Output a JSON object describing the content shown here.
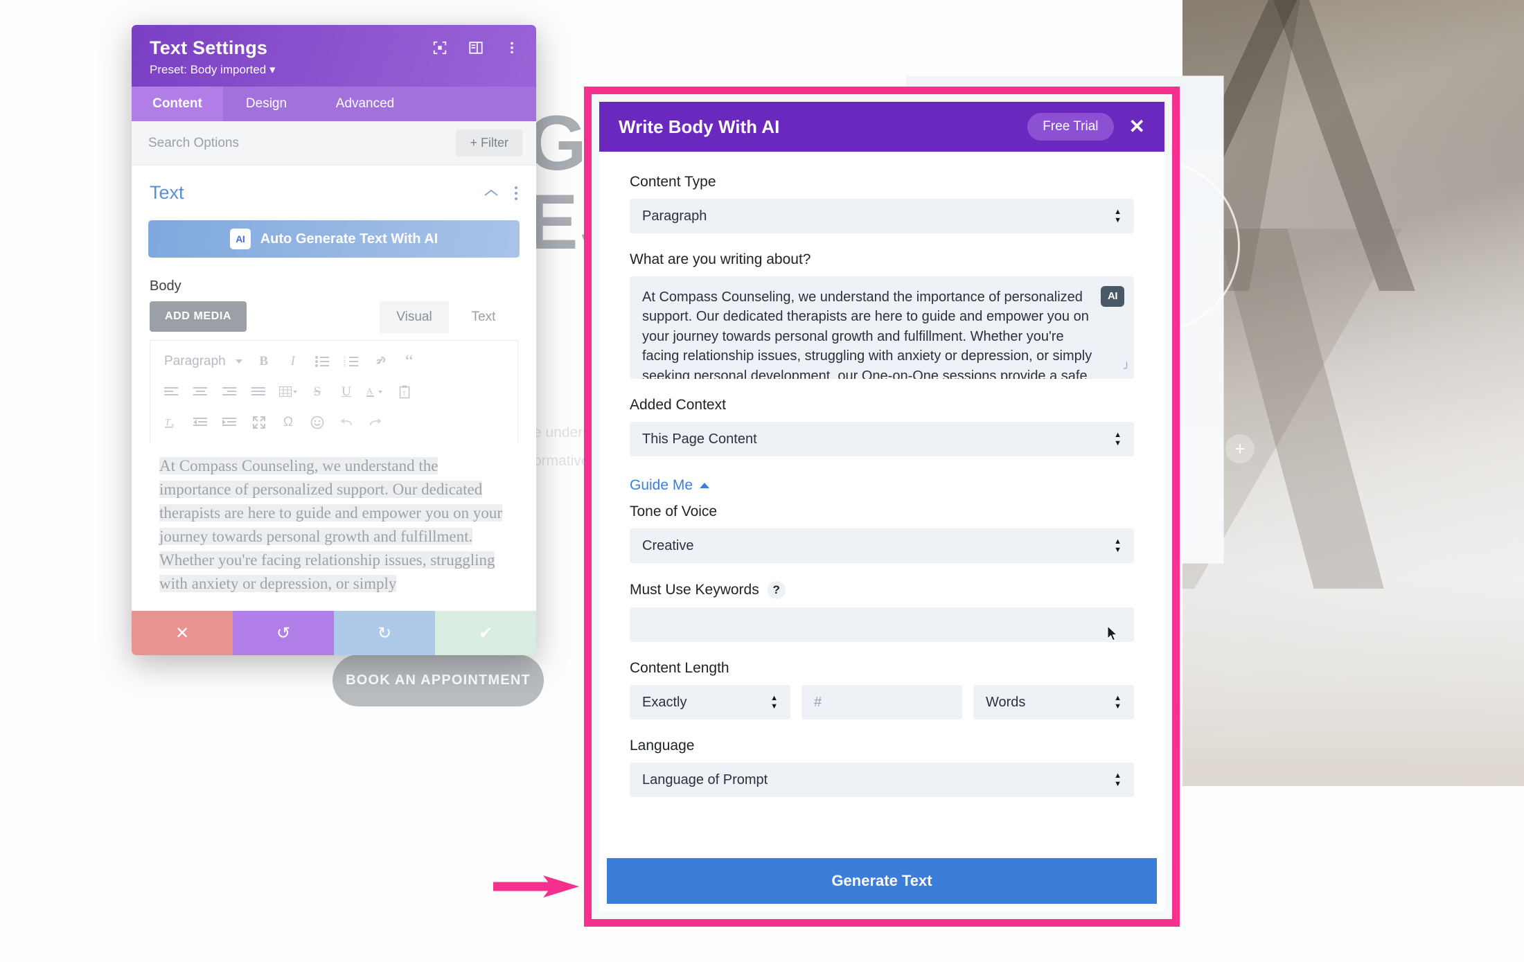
{
  "background_page": {
    "heading": "GIN\nES",
    "body_fragments": "e unders\nere to\nether\ning p\nyou to\ncan disc\normative",
    "cta_label": "BOOK AN APPOINTMENT",
    "add_icon": "plus-icon"
  },
  "settings_panel": {
    "title": "Text Settings",
    "preset": "Preset: Body imported",
    "preset_caret": "▾",
    "header_icons": [
      "focus-target-icon",
      "layout-panel-icon",
      "more-vertical-icon"
    ],
    "tabs": [
      {
        "label": "Content",
        "active": true
      },
      {
        "label": "Design",
        "active": false
      },
      {
        "label": "Advanced",
        "active": false
      }
    ],
    "search_placeholder": "Search Options",
    "filter_label": "Filter",
    "filter_icon": "plus-icon",
    "section": {
      "title": "Text",
      "collapse_icon": "chevron-up-icon",
      "menu_icon": "more-vertical-icon"
    },
    "ai_generate_button": "Auto Generate Text With AI",
    "ai_chip_label": "AI",
    "body_label": "Body",
    "add_media_label": "ADD MEDIA",
    "editor_tabs": [
      {
        "label": "Visual",
        "active": true
      },
      {
        "label": "Text",
        "active": false
      }
    ],
    "toolbar": {
      "format_select": "Paragraph",
      "row1_icons": [
        "bold-icon",
        "italic-icon",
        "bulleted-list-icon",
        "numbered-list-icon",
        "link-icon",
        "blockquote-icon"
      ],
      "row2_icons": [
        "align-left-icon",
        "align-center-icon",
        "align-right-icon",
        "align-justify-icon",
        "table-icon",
        "strikethrough-icon",
        "underline-icon",
        "text-color-icon",
        "paste-as-text-icon"
      ],
      "row3_icons": [
        "clear-formatting-icon",
        "outdent-icon",
        "indent-icon",
        "fullscreen-icon",
        "special-character-icon",
        "emoji-icon",
        "undo-icon",
        "redo-icon"
      ]
    },
    "editor_content": "At Compass Counseling, we understand the importance of personalized support. Our dedicated therapists are here to guide and empower you on your journey towards personal growth and fulfillment. Whether you're facing relationship issues, struggling with anxiety or depression, or simply",
    "actions": [
      {
        "name": "cancel",
        "icon": "✕",
        "color": "#e99292"
      },
      {
        "name": "undo",
        "icon": "↺",
        "color": "#b07ee6"
      },
      {
        "name": "redo",
        "icon": "↻",
        "color": "#aecae8"
      },
      {
        "name": "save",
        "icon": "✔",
        "color": "#d8ece0"
      }
    ]
  },
  "ai_modal": {
    "title": "Write Body With AI",
    "trial_badge": "Free Trial",
    "close_icon": "✕",
    "fields": {
      "content_type_label": "Content Type",
      "content_type_value": "Paragraph",
      "prompt_label": "What are you writing about?",
      "prompt_value": "At Compass Counseling, we understand the importance of personalized support. Our dedicated therapists are here to guide and empower you on your journey towards personal growth and fulfillment. Whether you're facing relationship issues, struggling with anxiety or depression, or simply seeking personal development, our One-on-One sessions provide a safe and confidential space for you to explore your thoughts",
      "prompt_ai_badge": "AI",
      "added_context_label": "Added Context",
      "added_context_value": "This Page Content",
      "guide_me_label": "Guide Me",
      "tone_label": "Tone of Voice",
      "tone_value": "Creative",
      "keywords_label": "Must Use Keywords",
      "keywords_help": "?",
      "keywords_value": "",
      "content_length_label": "Content Length",
      "length_mode_value": "Exactly",
      "length_number_placeholder": "#",
      "length_unit_value": "Words",
      "language_label": "Language",
      "language_value": "Language of Prompt"
    },
    "generate_button": "Generate Text",
    "annotation": {
      "arrow_color": "#f5308f",
      "frame_color": "#f5308f"
    }
  }
}
